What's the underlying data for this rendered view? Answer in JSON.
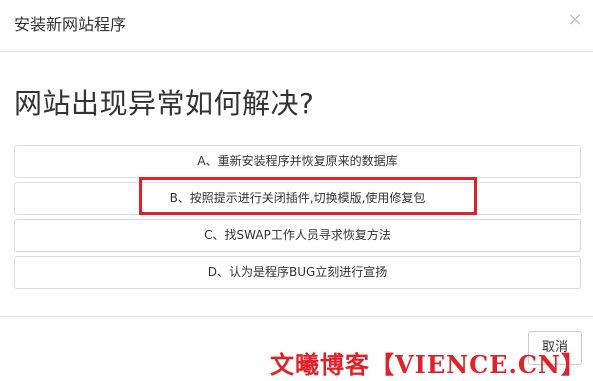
{
  "dialog": {
    "title": "安装新网站程序",
    "close_symbol": "×",
    "question": "网站出现异常如何解决?",
    "options": [
      {
        "label": "A、重新安装程序并恢复原来的数据库"
      },
      {
        "label": "B、按照提示进行关闭插件,切换模版,使用修复包"
      },
      {
        "label": "C、找SWAP工作人员寻求恢复方法"
      },
      {
        "label": "D、认为是程序BUG立刻进行宣扬"
      }
    ],
    "highlighted_option_index": 1,
    "highlight_color": "#e1202a",
    "cancel_label": "取消"
  },
  "watermark": {
    "text": "文曦博客【VIENCE.CN】",
    "color": "#e0232a"
  }
}
